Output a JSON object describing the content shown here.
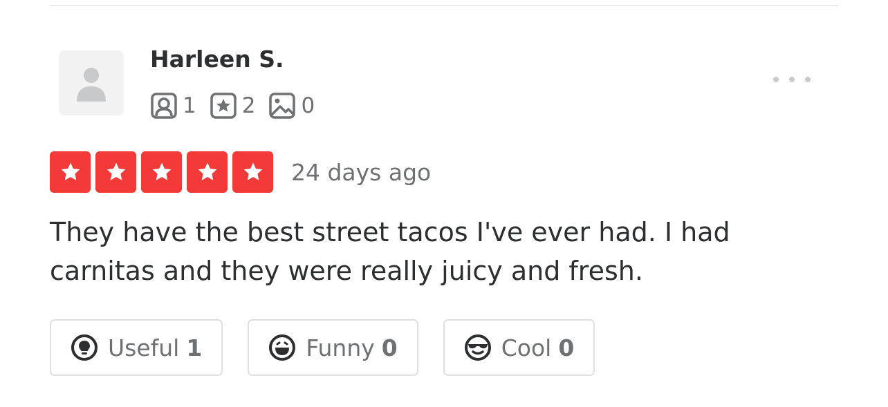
{
  "review": {
    "user": {
      "name": "Harleen S.",
      "avatar_icon": "default-user-icon",
      "stats": {
        "friends": "1",
        "reviews": "2",
        "photos": "0"
      }
    },
    "more_icon": "ellipsis-icon",
    "rating": 5,
    "rating_color": "#f43939",
    "date": "24 days ago",
    "text": "They have the best street tacos I've ever had. I had carnitas and they were really juicy and fresh.",
    "reactions": [
      {
        "label": "Useful",
        "count": "1",
        "icon": "lightbulb-icon"
      },
      {
        "label": "Funny",
        "count": "0",
        "icon": "laughing-face-icon"
      },
      {
        "label": "Cool",
        "count": "0",
        "icon": "sunglasses-face-icon"
      }
    ]
  }
}
